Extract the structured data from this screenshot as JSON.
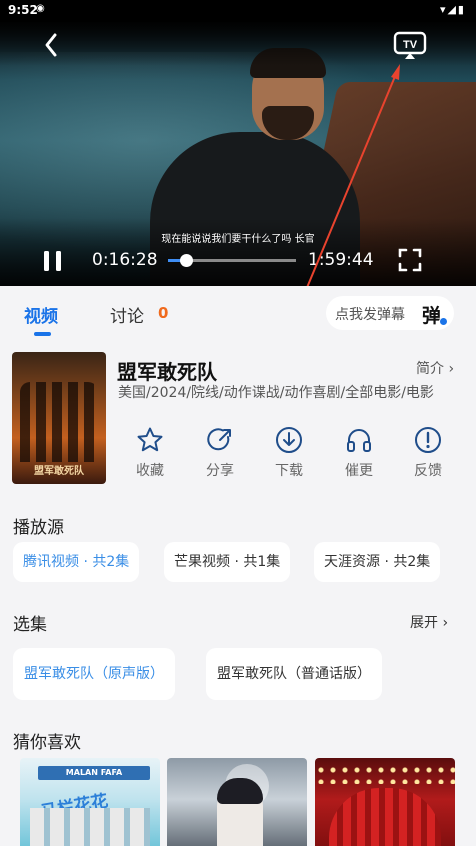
{
  "status_bar": {
    "time": "9:52",
    "notif": "◉",
    "right": "▾◢▮"
  },
  "player": {
    "subtitle": "现在能说说我们要干什么了吗  长官",
    "current_time": "0:16:28",
    "total_time": "1:59:44",
    "progress": 0.14,
    "tv_label": "TV",
    "icons": {
      "back": "chevron-left-icon",
      "cast": "tv-cast-icon",
      "pause": "pause-icon",
      "fullscreen": "fullscreen-icon"
    }
  },
  "tabs": {
    "video_label": "视频",
    "discuss_label": "讨论",
    "discuss_count": "0",
    "danmu_placeholder": "点我发弹幕",
    "danmu_icon": "弹"
  },
  "movie": {
    "poster_title": "盟军敢死队",
    "title": "盟军敢死队",
    "intro_link": "简介",
    "tags": "美国/2024/院线/动作谍战/动作喜剧/全部电影/电影"
  },
  "actions": [
    {
      "label": "收藏",
      "icon": "star-icon"
    },
    {
      "label": "分享",
      "icon": "share-icon"
    },
    {
      "label": "下载",
      "icon": "download-icon"
    },
    {
      "label": "催更",
      "icon": "headphones-icon"
    },
    {
      "label": "反馈",
      "icon": "feedback-icon"
    }
  ],
  "sources": {
    "title": "播放源",
    "items": [
      "腾讯视频 · 共2集",
      "芒果视频 · 共1集",
      "天涯资源 · 共2集"
    ],
    "selected": 0
  },
  "episodes": {
    "title": "选集",
    "expand_label": "展开",
    "items": [
      "盟军敢死队（原声版）",
      "盟军敢死队（普通话版）"
    ],
    "selected": 0
  },
  "recommend": {
    "title": "猜你喜欢",
    "thumb1_sign": "MALAN FAFA",
    "thumb1_text": "马栏花花"
  },
  "colors": {
    "accent": "#1a73e8",
    "count": "#f06a1d",
    "annotation_arrow": "#e8432e"
  }
}
